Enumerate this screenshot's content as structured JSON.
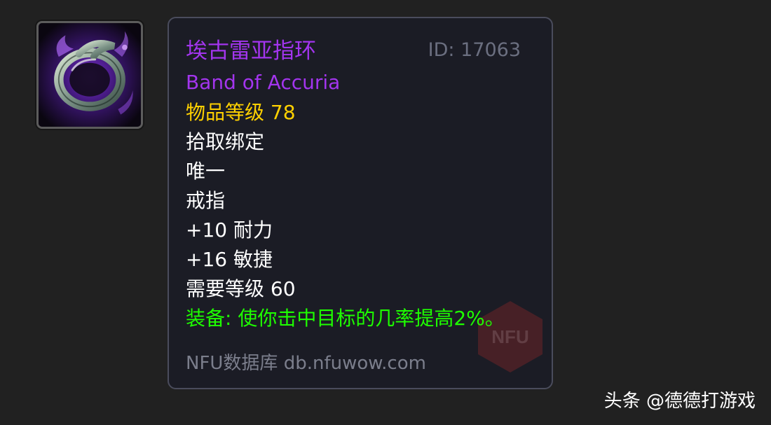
{
  "item": {
    "icon": "ring-icon",
    "name_cn": "埃古雷亚指环",
    "name_en": "Band of Accuria",
    "id_text": "ID: 17063",
    "item_level": "物品等级 78",
    "binding": "拾取绑定",
    "unique": "唯一",
    "slot": "戒指",
    "stats": [
      "+10 耐力",
      "+16 敏捷"
    ],
    "required_level": "需要等级 60",
    "equip_effect": "装备: 使你击中目标的几率提高2%。"
  },
  "footer": {
    "site": "NFU数据库 db.nfuwow.com",
    "watermark": "NFU"
  },
  "credit": "头条 @德德打游戏",
  "colors": {
    "epic_purple": "#a335ee",
    "item_level_gold": "#ffd100",
    "equip_green": "#1eff00",
    "muted_gray": "#6b6f80"
  }
}
